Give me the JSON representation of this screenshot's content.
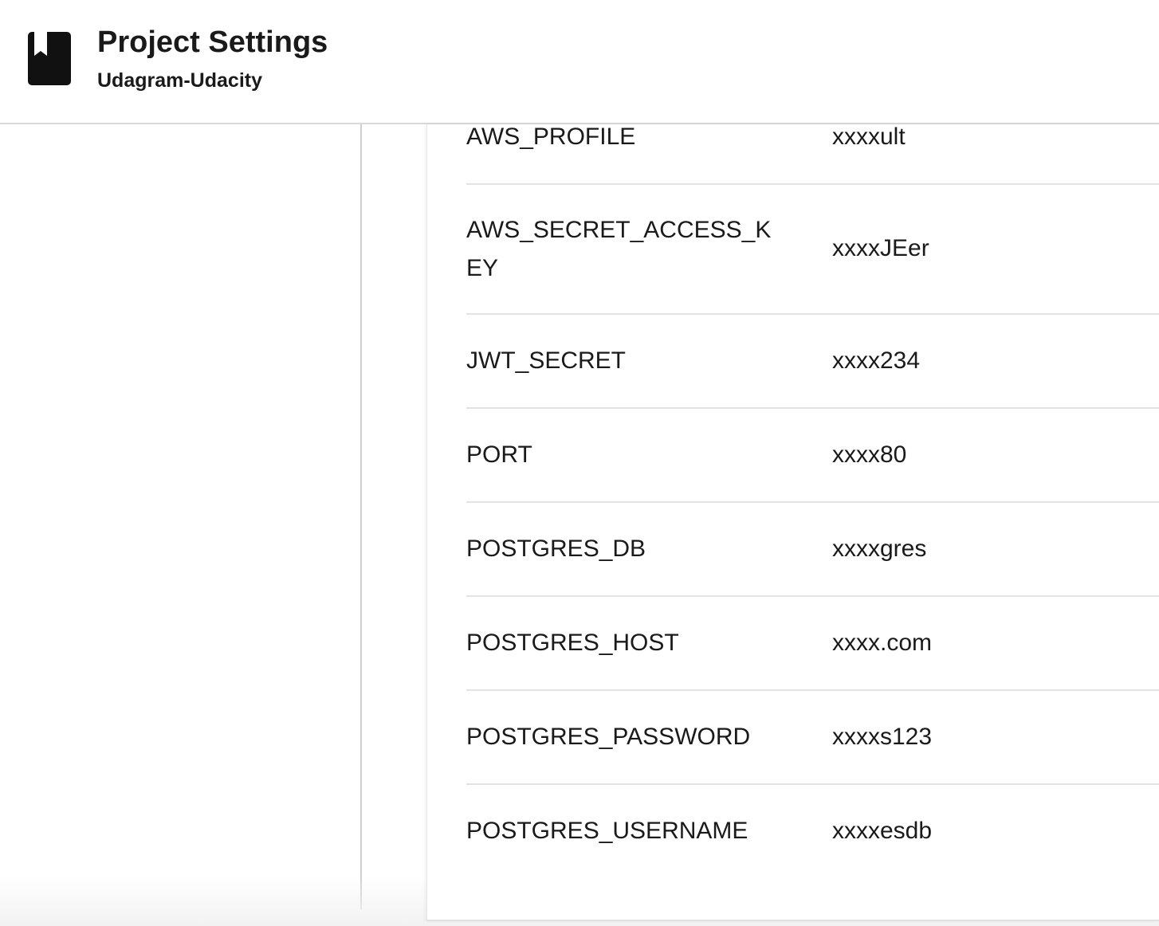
{
  "header": {
    "title": "Project Settings",
    "subtitle": "Udagram-Udacity",
    "icon": "bookmark-book-icon"
  },
  "env_vars": [
    {
      "key": "AWS_PROFILE",
      "value": "xxxxult"
    },
    {
      "key": "AWS_SECRET_ACCESS_KEY",
      "value": "xxxxJEer"
    },
    {
      "key": "JWT_SECRET",
      "value": "xxxx234"
    },
    {
      "key": "PORT",
      "value": "xxxx80"
    },
    {
      "key": "POSTGRES_DB",
      "value": "xxxxgres"
    },
    {
      "key": "POSTGRES_HOST",
      "value": "xxxx.com"
    },
    {
      "key": "POSTGRES_PASSWORD",
      "value": "xxxxs123"
    },
    {
      "key": "POSTGRES_USERNAME",
      "value": "xxxxesdb"
    }
  ]
}
